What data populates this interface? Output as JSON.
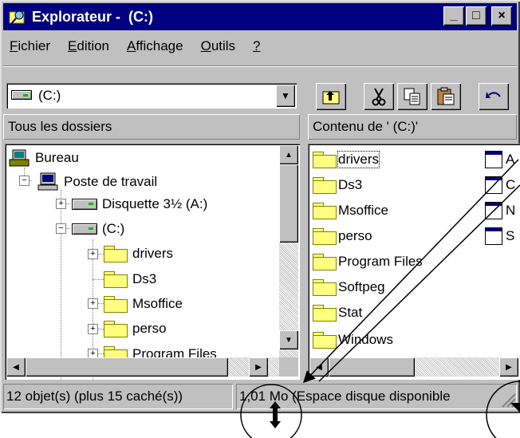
{
  "window": {
    "title": "Explorateur -  (C:)"
  },
  "title_buttons": {
    "minimize": "_",
    "maximize": "□",
    "close": "×"
  },
  "menu": [
    {
      "first": "F",
      "rest": "ichier"
    },
    {
      "first": "E",
      "rest": "dition"
    },
    {
      "first": "A",
      "rest": "ffichage"
    },
    {
      "first": "O",
      "rest": "utils"
    },
    {
      "first": "?",
      "rest": ""
    }
  ],
  "toolbar": {
    "drive_value": "(C:)",
    "icons": [
      "up-folder-icon",
      "cut-icon",
      "copy-icon",
      "paste-icon",
      "undo-icon"
    ]
  },
  "left_pane": {
    "header": "Tous les dossiers",
    "items": [
      {
        "label": "Bureau",
        "icon": "desktop-icon"
      },
      {
        "label": "Poste de travail",
        "icon": "computer-icon"
      },
      {
        "label": "Disquette 3½ (A:)",
        "icon": "floppy-drive-icon"
      },
      {
        "label": "(C:)",
        "icon": "hard-drive-icon"
      },
      {
        "label": "drivers",
        "icon": "folder-icon"
      },
      {
        "label": "Ds3",
        "icon": "folder-icon"
      },
      {
        "label": "Msoffice",
        "icon": "folder-icon"
      },
      {
        "label": "perso",
        "icon": "folder-icon"
      },
      {
        "label": "Program Files",
        "icon": "folder-icon"
      }
    ]
  },
  "right_pane": {
    "header": "Contenu de ' (C:)'",
    "folders": [
      "drivers",
      "Ds3",
      "Msoffice",
      "perso",
      "Program Files",
      "Softpeg",
      "Stat",
      "Windows"
    ],
    "files_partial": [
      "A",
      "C",
      "N",
      "S"
    ]
  },
  "statusbar": {
    "objects": "12 objet(s) (plus 15 caché(s))",
    "space": "1,01 Mo (Espace disque disponible"
  },
  "colors": {
    "titlebar": "#000080",
    "face": "#c0c0c0",
    "folder": "#ffff80"
  }
}
